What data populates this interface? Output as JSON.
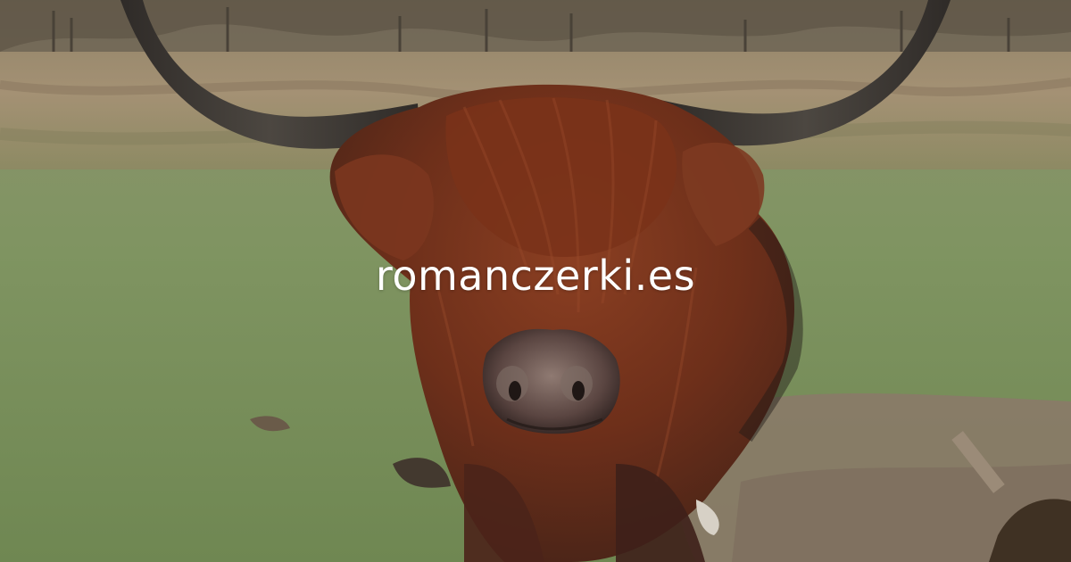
{
  "site": {
    "domain": "romanczerki.es"
  },
  "image": {
    "subject-icon": "highland-cow",
    "colors": {
      "grass": "#7f9164",
      "hair": "#6a2e1a",
      "horn": "#3d3a36",
      "soil": "#8a7a68"
    }
  }
}
